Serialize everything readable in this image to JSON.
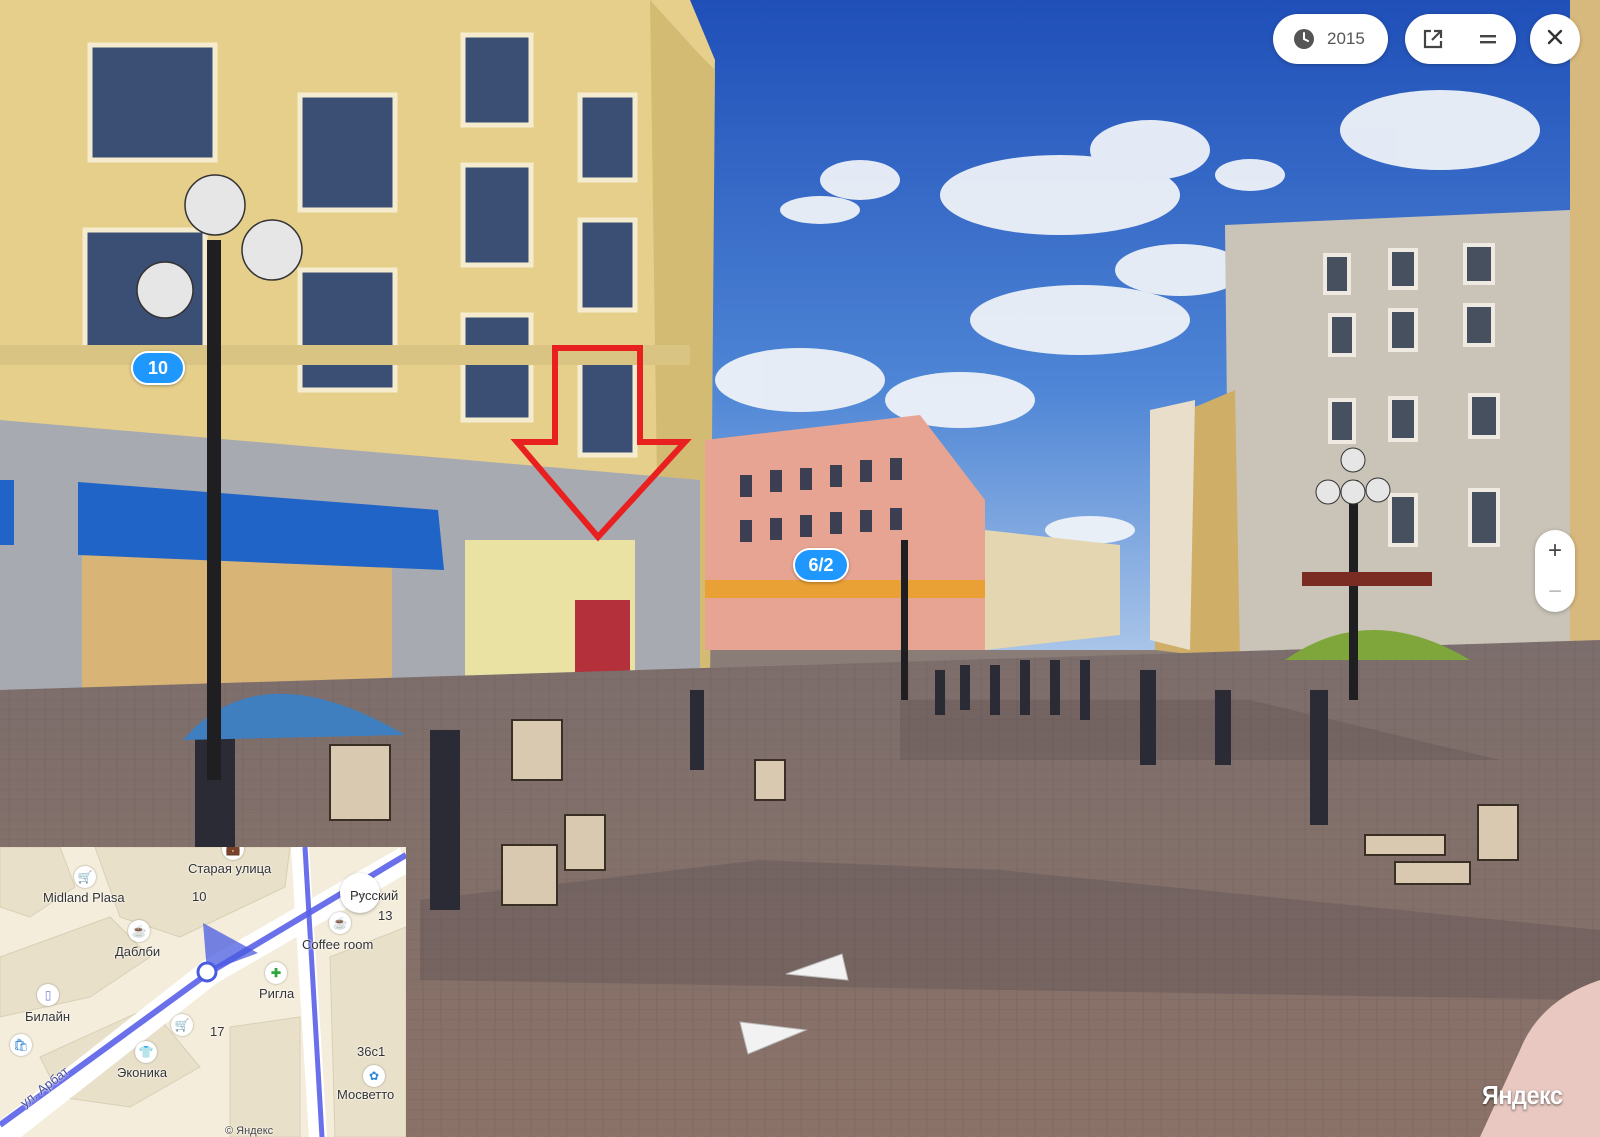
{
  "controls": {
    "year": "2015",
    "clock_icon": "clock-icon",
    "share_icon": "share-icon",
    "menu_icon": "menu-icon",
    "close_icon": "close-icon",
    "zoom_in": "+",
    "zoom_out": "−"
  },
  "house_pins": [
    "10",
    "6/2"
  ],
  "brand": "Яндекс",
  "minimap": {
    "expand_icon": "↔",
    "labels": {
      "midland": "Midland Plasa",
      "staraya": "Старая улица",
      "n10": "10",
      "russkiy": "Русский",
      "n13": "13",
      "dablby": "Даблби",
      "coffee": "Coffee room",
      "rigla": "Ригла",
      "beeline": "Билайн",
      "n17": "17",
      "n36": "36с1",
      "ekonika": "Эконика",
      "arbat": "ул. Арбат",
      "mosvett": "Мосветто",
      "copyright": "© Яндекс"
    }
  },
  "colors": {
    "accent": "#1e98ff",
    "arrow": "#e82020",
    "route": "#5a5fe8"
  }
}
